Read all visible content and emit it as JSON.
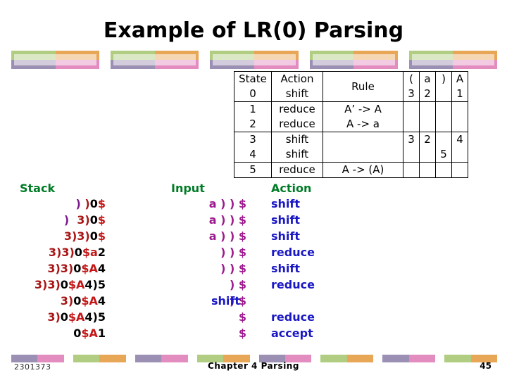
{
  "slide": {
    "title": "Example of LR(0) Parsing",
    "page_number": "45",
    "footer_center": "Chapter 4  Parsing",
    "footer_left": "2301373"
  },
  "colors": {
    "deco_green": "#b0cd82",
    "deco_orange": "#e8a657",
    "deco_purple": "#9c8fb4",
    "deco_pink": "#e28cc0",
    "header_green": "#007c26",
    "action_blue": "#1a17c4",
    "input_magenta": "#9c1a8e",
    "stack_red": "#c41616",
    "stack_purple": "#7a1a8e"
  },
  "parse_table": {
    "headers": {
      "state": "State",
      "action": "Action",
      "rule": "Rule",
      "terminals": [
        "(",
        "a",
        ")",
        "A"
      ]
    },
    "rows": [
      {
        "state": "0",
        "action": "shift",
        "rule": "",
        "goto": [
          "3",
          "2",
          "",
          "1"
        ]
      },
      {
        "state": "1",
        "action": "reduce",
        "rule": "A’ -> A",
        "goto": [
          "",
          "",
          "",
          ""
        ]
      },
      {
        "state": "2",
        "action": "reduce",
        "rule": "A -> a",
        "goto": [
          "",
          "",
          "",
          ""
        ]
      },
      {
        "state": "3",
        "action": "shift",
        "rule": "",
        "goto": [
          "3",
          "2",
          "",
          "4"
        ]
      },
      {
        "state": "4",
        "action": "shift",
        "rule": "",
        "goto": [
          "",
          "",
          "5",
          ""
        ]
      },
      {
        "state": "5",
        "action": "reduce",
        "rule": "A -> (A)",
        "goto": [
          "",
          "",
          "",
          ""
        ]
      }
    ]
  },
  "trace": {
    "headers": {
      "stack": "Stack",
      "input": "Input",
      "action": "Action"
    },
    "rows": [
      {
        "stack_purple": ")",
        "stack_gap": " ",
        "stack_dark": ")",
        "stack_black": "0",
        "stack_red": "$",
        "stack_tail": "",
        "input": "a ) ) $",
        "action": "shift",
        "inline": false
      },
      {
        "stack_purple": ")",
        "stack_gap": "  ",
        "stack_dark": "3)",
        "stack_black": "0",
        "stack_red": "$",
        "stack_tail": "",
        "input": "a ) ) $",
        "action": "shift",
        "inline": false
      },
      {
        "stack_purple": "",
        "stack_gap": "",
        "stack_dark": "3)3)",
        "stack_black": "0",
        "stack_red": "$",
        "stack_tail": "",
        "input": "a ) ) $",
        "action": "shift",
        "inline": false
      },
      {
        "stack_purple": "",
        "stack_gap": "",
        "stack_dark": "3)3)",
        "stack_black": "0",
        "stack_red": "$a",
        "stack_tail": "2",
        "input": ") ) $",
        "action": "reduce",
        "inline": false
      },
      {
        "stack_purple": "",
        "stack_gap": "",
        "stack_dark": "3)3)",
        "stack_black": "0",
        "stack_red": "$A",
        "stack_tail": "4",
        "input": ") ) $",
        "action": "shift",
        "inline": false
      },
      {
        "stack_purple": "",
        "stack_gap": "",
        "stack_dark": "3)3)",
        "stack_black": "0",
        "stack_red": "$A",
        "stack_tail": "4)5",
        "input": ") $",
        "action": "reduce",
        "inline": false
      },
      {
        "stack_purple": "",
        "stack_gap": "",
        "stack_dark": "3)",
        "stack_black": "0",
        "stack_red": "$A",
        "stack_tail": "4",
        "input": ") $",
        "action": "shift",
        "inline": true
      },
      {
        "stack_purple": "",
        "stack_gap": "",
        "stack_dark": "3)",
        "stack_black": "0",
        "stack_red": "$A",
        "stack_tail": "4)5",
        "input": "$",
        "action": "reduce",
        "inline": false
      },
      {
        "stack_purple": "",
        "stack_gap": "",
        "stack_dark": "",
        "stack_black": "0",
        "stack_red": "$A",
        "stack_tail": "1",
        "input": "$",
        "action": "accept",
        "inline": false
      }
    ]
  }
}
